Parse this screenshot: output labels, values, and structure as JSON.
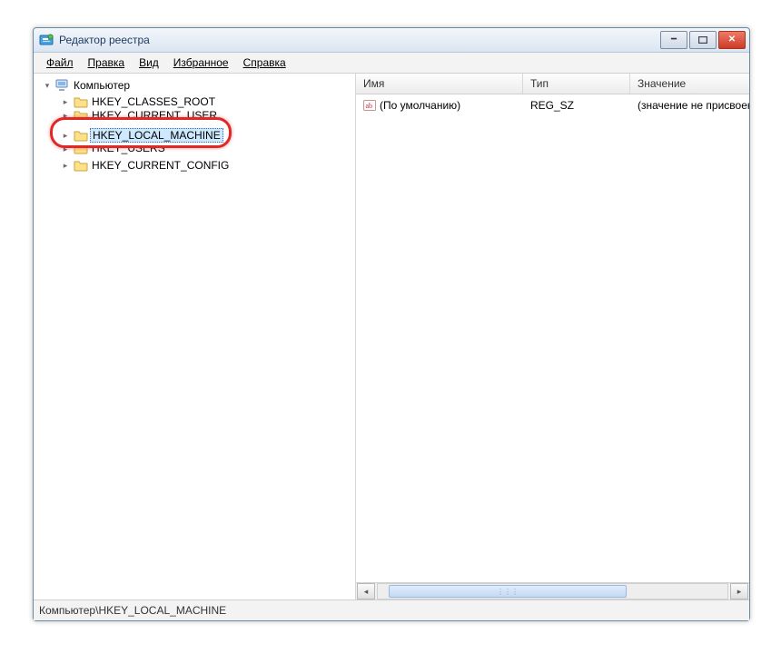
{
  "window": {
    "title": "Редактор реестра"
  },
  "menu": {
    "file": "Файл",
    "edit": "Правка",
    "view": "Вид",
    "fav": "Избранное",
    "help": "Справка"
  },
  "tree": {
    "root": "Компьютер",
    "items": [
      "HKEY_CLASSES_ROOT",
      "HKEY_CURRENT_USER",
      "HKEY_LOCAL_MACHINE",
      "HKEY_USERS",
      "HKEY_CURRENT_CONFIG"
    ],
    "selected_index": 2
  },
  "list": {
    "columns": {
      "name": "Имя",
      "type": "Тип",
      "value": "Значение"
    },
    "rows": [
      {
        "name": "(По умолчанию)",
        "type": "REG_SZ",
        "value": "(значение не присвоено)"
      }
    ]
  },
  "status": {
    "path": "Компьютер\\HKEY_LOCAL_MACHINE"
  }
}
